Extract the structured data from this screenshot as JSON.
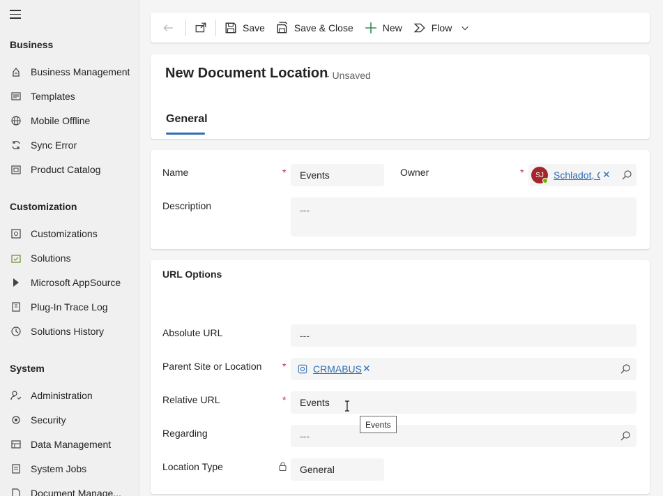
{
  "sidebar": {
    "groups": [
      {
        "title": "Business",
        "items": [
          {
            "label": "Business Management",
            "icon": "business-management-icon"
          },
          {
            "label": "Templates",
            "icon": "templates-icon"
          },
          {
            "label": "Mobile Offline",
            "icon": "globe-icon"
          },
          {
            "label": "Sync Error",
            "icon": "sync-icon"
          },
          {
            "label": "Product Catalog",
            "icon": "product-catalog-icon"
          }
        ]
      },
      {
        "title": "Customization",
        "items": [
          {
            "label": "Customizations",
            "icon": "customizations-icon"
          },
          {
            "label": "Solutions",
            "icon": "solutions-icon"
          },
          {
            "label": "Microsoft AppSource",
            "icon": "appsource-icon"
          },
          {
            "label": "Plug-In Trace Log",
            "icon": "trace-log-icon"
          },
          {
            "label": "Solutions History",
            "icon": "history-icon"
          }
        ]
      },
      {
        "title": "System",
        "items": [
          {
            "label": "Administration",
            "icon": "administration-icon"
          },
          {
            "label": "Security",
            "icon": "security-icon"
          },
          {
            "label": "Data Management",
            "icon": "data-management-icon"
          },
          {
            "label": "System Jobs",
            "icon": "system-jobs-icon"
          },
          {
            "label": "Document Manage...",
            "icon": "document-management-icon"
          }
        ]
      }
    ]
  },
  "toolbar": {
    "save": "Save",
    "save_close": "Save & Close",
    "new": "New",
    "flow": "Flow"
  },
  "header": {
    "title": "New Document Location",
    "status": "- Unsaved",
    "tab": "General"
  },
  "general": {
    "name_label": "Name",
    "name_value": "Events",
    "owner_label": "Owner",
    "owner_value": "Schladot, C",
    "owner_initials": "SJ",
    "description_label": "Description",
    "description_value": "---"
  },
  "url_options": {
    "title": "URL Options",
    "absolute_url_label": "Absolute URL",
    "absolute_url_value": "---",
    "parent_label": "Parent Site or Location",
    "parent_value": "CRMABUS",
    "relative_url_label": "Relative URL",
    "relative_url_value": "Events",
    "regarding_label": "Regarding",
    "regarding_value": "---",
    "location_type_label": "Location Type",
    "location_type_value": "General"
  },
  "tooltip": "Events",
  "colors": {
    "accent": "#2f6fb4",
    "required": "#c4314b",
    "avatar": "#a4262c",
    "presence": "#6bb700"
  }
}
